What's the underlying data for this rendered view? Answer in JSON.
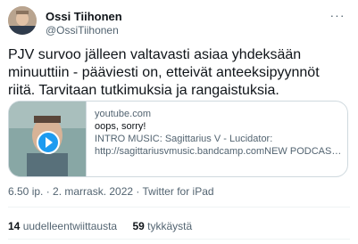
{
  "author": {
    "display_name": "Ossi Tiihonen",
    "handle": "@OssiTiihonen"
  },
  "tweet": {
    "text_line1": "PJV survoo jälleen valtavasti asiaa yhdeksään",
    "text_line2": "minuuttiin - pääviesti on, etteivät anteeksipyynnöt",
    "text_line3": "riitä. Tarvitaan tutkimuksia ja rangaistuksia."
  },
  "card": {
    "domain": "youtube.com",
    "title": "oops, sorry!",
    "description_line1": "INTRO MUSIC: Sagittarius V - Lucidator:",
    "description_line2": "http://sagittariusvmusic.bandcamp.comNEW PODCAST: ..."
  },
  "meta": {
    "timestamp": "6.50 ip. · 2. marrask. 2022 · Twitter for iPad"
  },
  "stats": {
    "retweets_count": "14",
    "retweets_label": "uudelleentwiittausta",
    "likes_count": "59",
    "likes_label": "tykkäystä"
  },
  "icons": {
    "more": "more-horizontal-icon",
    "play": "play-icon"
  },
  "colors": {
    "accent": "#1d9bf0",
    "text_primary": "#0f1419",
    "text_secondary": "#536471",
    "border": "#cfd9de"
  }
}
